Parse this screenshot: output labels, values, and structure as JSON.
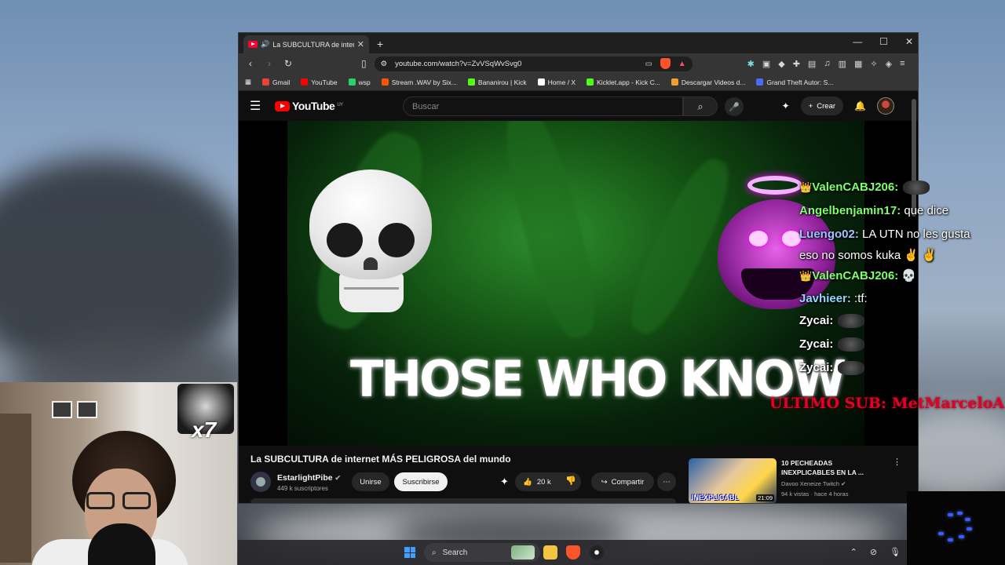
{
  "browser": {
    "tab_title": "La SUBCULTURA de internet M",
    "new_tab": "+",
    "window_controls": {
      "minimize": "—",
      "maximize": "☐",
      "close": "✕"
    },
    "url": "youtube.com/watch?v=ZvVSqWvSvg0",
    "bookmarks": [
      {
        "label": "Gmail",
        "color": "#ea4335"
      },
      {
        "label": "YouTube",
        "color": "#ff0000"
      },
      {
        "label": "wsp",
        "color": "#25d366"
      },
      {
        "label": "Stream .WAV by Six...",
        "color": "#ff5500"
      },
      {
        "label": "Bananirou | Kick",
        "color": "#53fc18"
      },
      {
        "label": "Home / X",
        "color": "#ffffff"
      },
      {
        "label": "Kicklet.app - Kick C...",
        "color": "#53fc18"
      },
      {
        "label": "Descargar Videos d...",
        "color": "#f0a030"
      },
      {
        "label": "Grand Theft Autor: S...",
        "color": "#4a6cf7"
      }
    ]
  },
  "youtube": {
    "logo_text": "YouTube",
    "country": "UY",
    "search_placeholder": "Buscar",
    "create_label": "Crear",
    "video": {
      "caption": "THOSE WHO KNOW",
      "title": "La SUBCULTURA de internet MÁS PELIGROSA del mundo",
      "channel": "EstarlightPibe",
      "subscribers": "449 k suscriptores",
      "join_label": "Unirse",
      "subscribe_label": "Suscribirse",
      "likes": "20 k",
      "share_label": "Compartir"
    },
    "recommended": {
      "title": "10 PECHEADAS INEXPLICABLES EN LA ...",
      "channel": "Davoo Xeneize Twitch",
      "meta": "94 k vistas · hace 4 horas",
      "duration": "21:09",
      "thumb_text": "INEXPLICABL"
    }
  },
  "stream": {
    "chat": [
      {
        "user": "ValenCABJ206:",
        "text": "",
        "color": "#7dff6b",
        "crown": true,
        "emote": true
      },
      {
        "user": "Angelbenjamin17:",
        "text": " que dice",
        "color": "#7dff6b",
        "crown": false,
        "emote": false
      },
      {
        "user": "Luengo02:",
        "text": " LA UTN no les gusta",
        "color": "#9ec3ff",
        "crown": false,
        "emote": false
      },
      {
        "user": "",
        "text": "eso no somos kuka ✌ ✌",
        "color": "#ffffff",
        "crown": false,
        "emote": false
      },
      {
        "user": "ValenCABJ206:",
        "text": " 💀",
        "color": "#7dff6b",
        "crown": true,
        "emote": false
      },
      {
        "user": "Javhieer:",
        "text": " :tf:",
        "color": "#8fd8ff",
        "crown": false,
        "emote": false
      },
      {
        "user": "Zycai:",
        "text": "",
        "color": "#ffffff",
        "crown": false,
        "emote": true
      },
      {
        "user": "Zycai:",
        "text": "",
        "color": "#ffffff",
        "crown": false,
        "emote": true
      },
      {
        "user": "Zycai:",
        "text": "",
        "color": "#ffffff",
        "crown": false,
        "emote": true
      }
    ],
    "last_sub": "ULTIMO SUB: MetMarceloA",
    "reaction_count": "x7"
  },
  "taskbar": {
    "search_label": "Search"
  }
}
